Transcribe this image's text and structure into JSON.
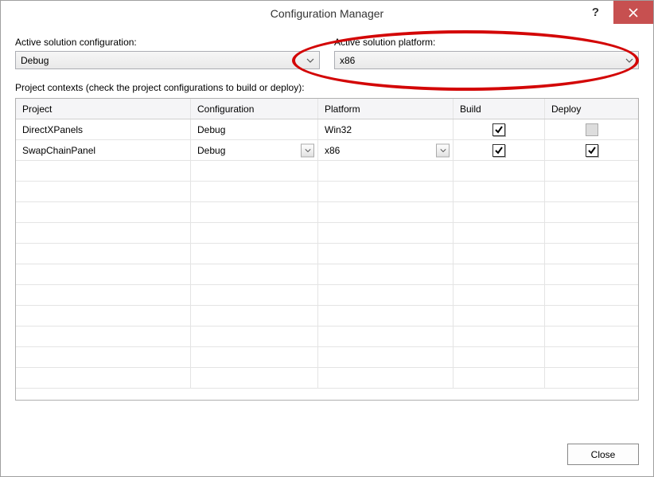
{
  "window": {
    "title": "Configuration Manager"
  },
  "labels": {
    "active_config": "Active solution configuration:",
    "active_platform": "Active solution platform:",
    "contexts": "Project contexts (check the project configurations to build or deploy):"
  },
  "active": {
    "config": "Debug",
    "platform": "x86"
  },
  "columns": {
    "project": "Project",
    "config": "Configuration",
    "platform": "Platform",
    "build": "Build",
    "deploy": "Deploy"
  },
  "rows": [
    {
      "project": "DirectXPanels",
      "config": "Debug",
      "config_dd": false,
      "platform": "Win32",
      "platform_dd": false,
      "build": true,
      "deploy": false,
      "deploy_enabled": false
    },
    {
      "project": "SwapChainPanel",
      "config": "Debug",
      "config_dd": true,
      "platform": "x86",
      "platform_dd": true,
      "build": true,
      "deploy": true,
      "deploy_enabled": true
    }
  ],
  "footer": {
    "close": "Close"
  }
}
